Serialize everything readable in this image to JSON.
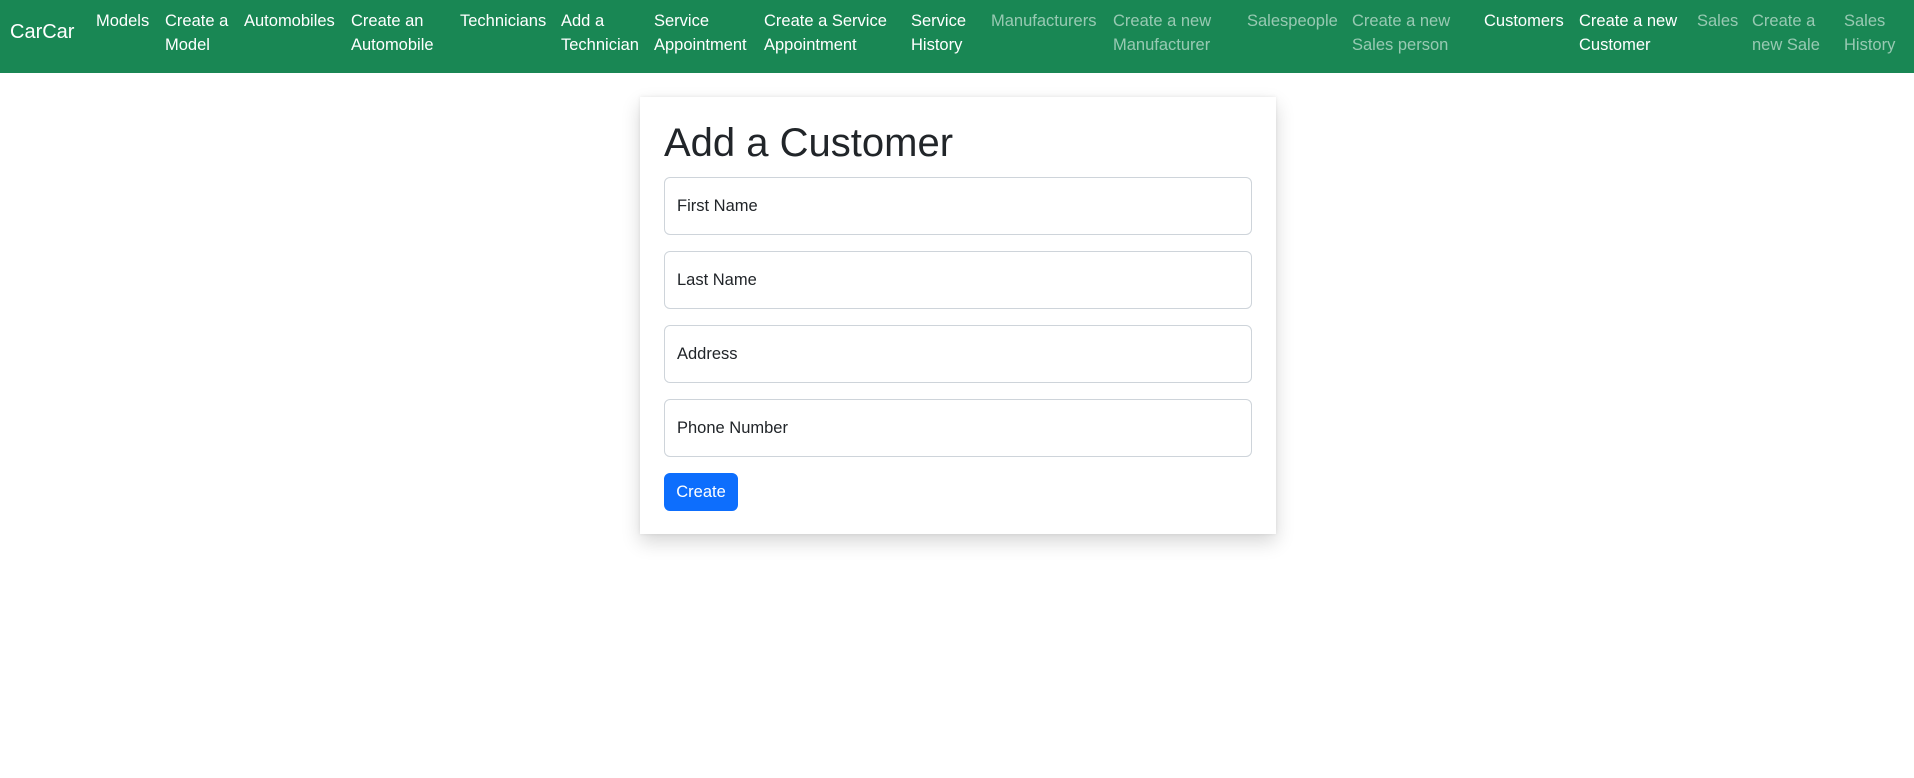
{
  "navbar": {
    "brand": "CarCar",
    "links": [
      {
        "line1": "Models",
        "line2": "",
        "muted": false
      },
      {
        "line1": "Create a",
        "line2": "Model",
        "muted": false
      },
      {
        "line1": "Automobiles",
        "line2": "",
        "muted": false
      },
      {
        "line1": "Create an",
        "line2": "Automobile",
        "muted": false
      },
      {
        "line1": "Technicians",
        "line2": "",
        "muted": false
      },
      {
        "line1": "Add a",
        "line2": "Technician",
        "muted": false
      },
      {
        "line1": "Service",
        "line2": "Appointment",
        "muted": false
      },
      {
        "line1": "Create a Service",
        "line2": "Appointment",
        "muted": false
      },
      {
        "line1": "Service",
        "line2": "History",
        "muted": false
      },
      {
        "line1": "Manufacturers",
        "line2": "",
        "muted": true
      },
      {
        "line1": "Create a new",
        "line2": "Manufacturer",
        "muted": true
      },
      {
        "line1": "Salespeople",
        "line2": "",
        "muted": true
      },
      {
        "line1": "Create a new",
        "line2": "Sales person",
        "muted": true
      },
      {
        "line1": "Customers",
        "line2": "",
        "muted": false
      },
      {
        "line1": "Create a new",
        "line2": "Customer",
        "muted": false
      },
      {
        "line1": "Sales",
        "line2": "",
        "muted": true
      },
      {
        "line1": "Create a",
        "line2": "new Sale",
        "muted": true
      },
      {
        "line1": "Sales",
        "line2": "History",
        "muted": true
      }
    ]
  },
  "form": {
    "title": "Add a Customer",
    "fields": {
      "first_name": {
        "placeholder": "First Name",
        "value": ""
      },
      "last_name": {
        "placeholder": "Last Name",
        "value": ""
      },
      "address": {
        "placeholder": "Address",
        "value": ""
      },
      "phone_number": {
        "placeholder": "Phone Number",
        "value": ""
      }
    },
    "submit_label": "Create"
  },
  "colors": {
    "navbar_bg": "#198754",
    "primary_button": "#0d6efd",
    "muted_link": "rgba(255,255,255,0.55)"
  }
}
